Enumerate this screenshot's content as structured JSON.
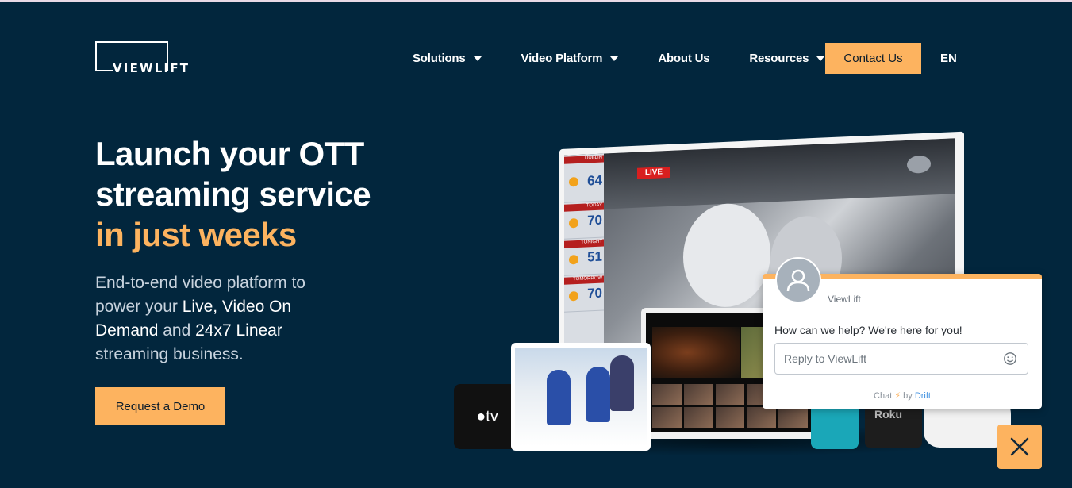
{
  "brand": {
    "logo_text": "VIEWLIFT"
  },
  "nav": {
    "items": [
      {
        "label": "Solutions",
        "has_dropdown": true
      },
      {
        "label": "Video Platform",
        "has_dropdown": true
      },
      {
        "label": "About Us",
        "has_dropdown": false
      },
      {
        "label": "Resources",
        "has_dropdown": true
      }
    ],
    "contact_label": "Contact Us",
    "language": "EN"
  },
  "hero": {
    "title_line1": "Launch your OTT",
    "title_line2": "streaming service",
    "title_accent": "in just weeks",
    "subtitle_parts": [
      "End-to-end video platform to power your ",
      "Live, Video On Demand",
      " and ",
      "24x7 Linear",
      " streaming business."
    ],
    "cta_label": "Request a Demo"
  },
  "devices": {
    "live_badge": "LIVE",
    "weather_labels": [
      "DUBLIN",
      "TODAY",
      "TONIGHT",
      "TOMORROW"
    ],
    "weather_values": [
      "64",
      "70",
      "51",
      "70"
    ],
    "apple_tv_text": "tv",
    "roku_text": "Roku"
  },
  "chat": {
    "agent_name": "ViewLift",
    "message": "How can we help? We're here for you!",
    "input_placeholder": "Reply to ViewLift",
    "powered_prefix": "Chat",
    "powered_by": "by",
    "powered_brand": "Drift"
  },
  "colors": {
    "background": "#02263d",
    "accent": "#fdb35f",
    "chat_link": "#3d8fe0"
  }
}
